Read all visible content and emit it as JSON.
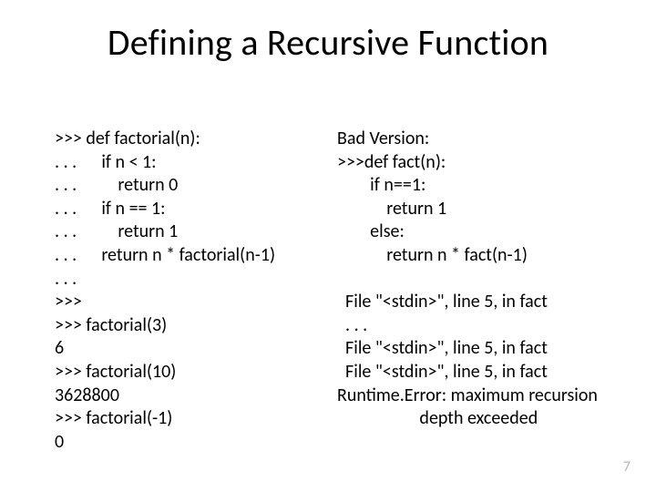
{
  "title": "Defining a Recursive Function",
  "left_code": ">>> def factorial(n):\n. . .      if n < 1:\n. . .          return 0\n. . .      if n == 1:\n. . .          return 1\n. . .      return n * factorial(n-1)\n. . .\n>>>\n>>> factorial(3)\n6\n>>> factorial(10)\n3628800\n>>> factorial(-1)\n0",
  "right_code": "Bad Version:\n>>>def fact(n):\n        if n==1:\n            return 1\n        else:\n            return n * fact(n-1)\n\n  File \"<stdin>\", line 5, in fact\n  . . .\n  File \"<stdin>\", line 5, in fact\n  File \"<stdin>\", line 5, in fact\nRuntime.Error: maximum recursion\n                    depth exceeded",
  "page_number": "7"
}
